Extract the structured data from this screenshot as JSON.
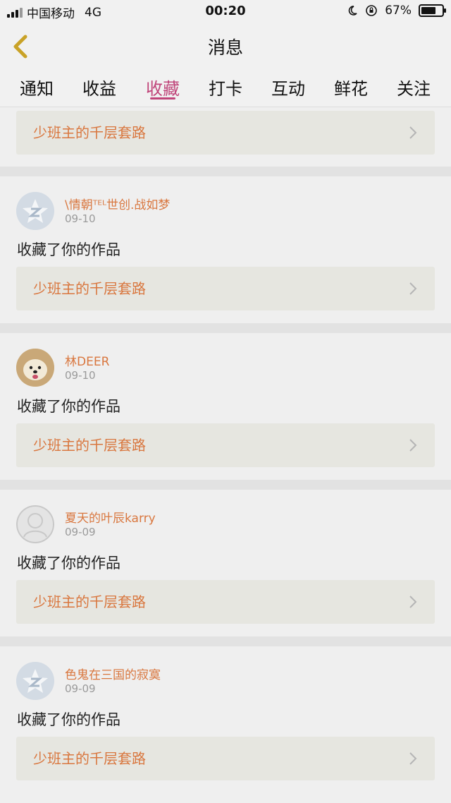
{
  "status_bar": {
    "carrier": "中国移动",
    "network": "4G",
    "time": "00:20",
    "battery": "67%"
  },
  "header": {
    "title": "消息"
  },
  "tabs": [
    {
      "label": "通知"
    },
    {
      "label": "收益"
    },
    {
      "label": "收藏"
    },
    {
      "label": "打卡"
    },
    {
      "label": "互动"
    },
    {
      "label": "鲜花"
    },
    {
      "label": "关注"
    }
  ],
  "first_item": {
    "work_title": "少班主的千层套路"
  },
  "items": [
    {
      "username": "\\情朝ᵀᴱᴸ世创.战如梦",
      "date": "09-10",
      "action": "收藏了你的作品",
      "work_title": "少班主的千层套路",
      "avatar": "star-badge-icon"
    },
    {
      "username": "林DEER",
      "date": "09-10",
      "action": "收藏了你的作品",
      "work_title": "少班主的千层套路",
      "avatar": "dog-photo"
    },
    {
      "username": "夏天的叶辰karry",
      "date": "09-09",
      "action": "收藏了你的作品",
      "work_title": "少班主的千层套路",
      "avatar": "default-user-icon"
    },
    {
      "username": "色鬼在三国的寂寞",
      "date": "09-09",
      "action": "收藏了你的作品",
      "work_title": "少班主的千层套路",
      "avatar": "star-badge-icon"
    }
  ],
  "colors": {
    "accent": "#c0457a",
    "link": "#d9773f"
  }
}
